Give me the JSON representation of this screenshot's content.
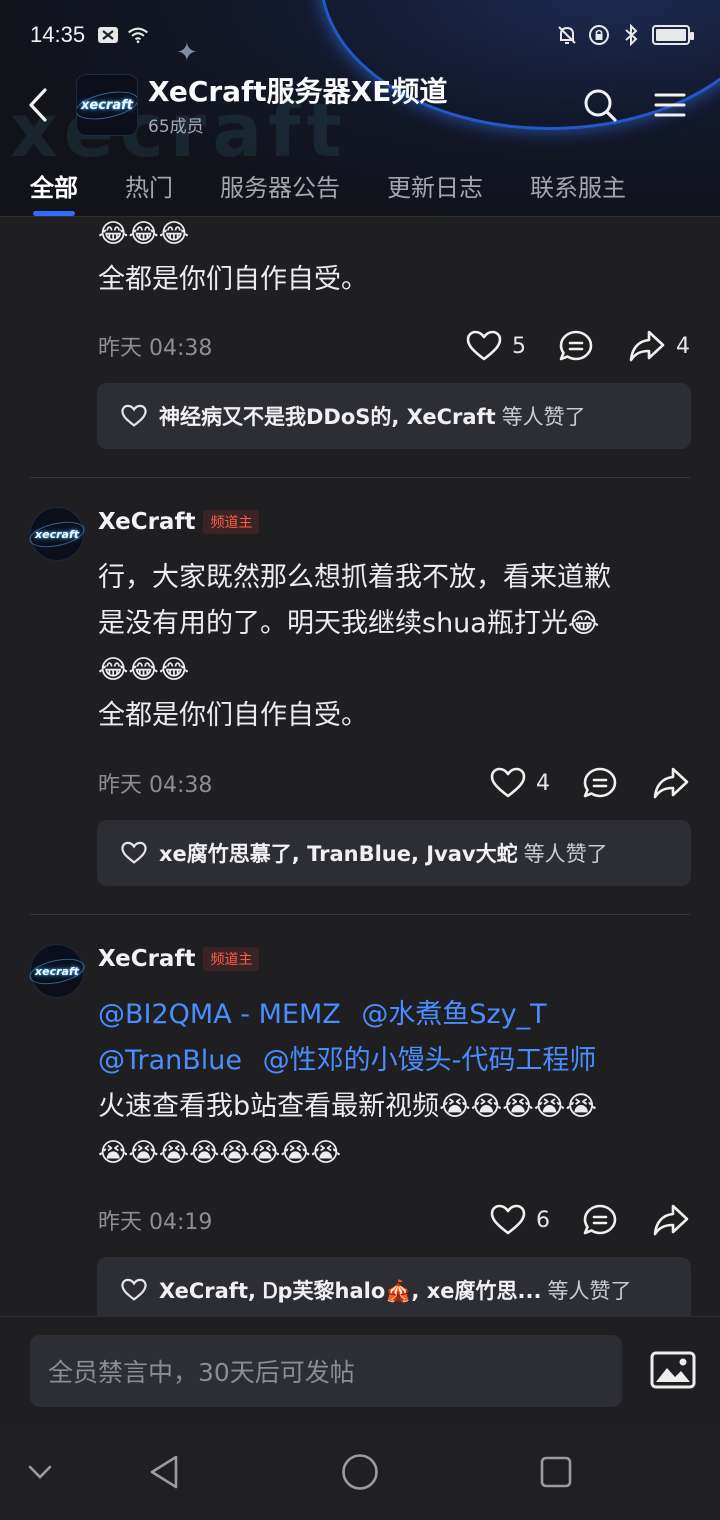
{
  "status_bar": {
    "time": "14:35"
  },
  "header": {
    "channel_name": "XeCraft服务器XE频道",
    "members": "65成员",
    "logo_text": "xecraft",
    "watermark": "xecraft"
  },
  "tabs": [
    {
      "label": "全部",
      "active": true
    },
    {
      "label": "热门",
      "active": false
    },
    {
      "label": "服务器公告",
      "active": false
    },
    {
      "label": "更新日志",
      "active": false
    },
    {
      "label": "联系服主",
      "active": false
    }
  ],
  "posts": [
    {
      "body_lines": [
        "😂😂😂",
        "全都是你们自作自受。"
      ],
      "time": "昨天 04:38",
      "like_count": "5",
      "share_count": "4",
      "likers": "神经病又不是我DDoS的, XeCraft",
      "likers_suffix": "等人赞了"
    },
    {
      "author": "XeCraft",
      "role": "频道主",
      "body_lines": [
        "行，大家既然那么想抓着我不放，看来道歉",
        "是没有用的了。明天我继续shua瓶打光😂",
        "😂😂😂",
        "全都是你们自作自受。"
      ],
      "time": "昨天 04:38",
      "like_count": "4",
      "likers": "xe腐竹思慕了, TranBlue, Jvav大蛇",
      "likers_suffix": "等人赞了"
    },
    {
      "author": "XeCraft",
      "role": "频道主",
      "mentions_line1": [
        "@BI2QMA - MEMZ",
        "@水煮鱼Szy_T"
      ],
      "mentions_line2": [
        "@TranBlue",
        "@性邓的小馒头-代码工程师"
      ],
      "body_lines": [
        "火速查看我b站查看最新视频😭😭😭😭😭",
        "😭😭😭😭😭😭😭😭"
      ],
      "time": "昨天 04:19",
      "like_count": "6",
      "likers": "XeCraft, Ꭰp芙黎halo🎪, xe腐竹思...",
      "likers_suffix": "等人赞了"
    }
  ],
  "composer": {
    "placeholder": "全员禁言中，30天后可发帖"
  },
  "colors": {
    "accent": "#2f6cff",
    "mention": "#4a8dff",
    "badge_text": "#ff5a4a",
    "background": "#1f1f22"
  }
}
